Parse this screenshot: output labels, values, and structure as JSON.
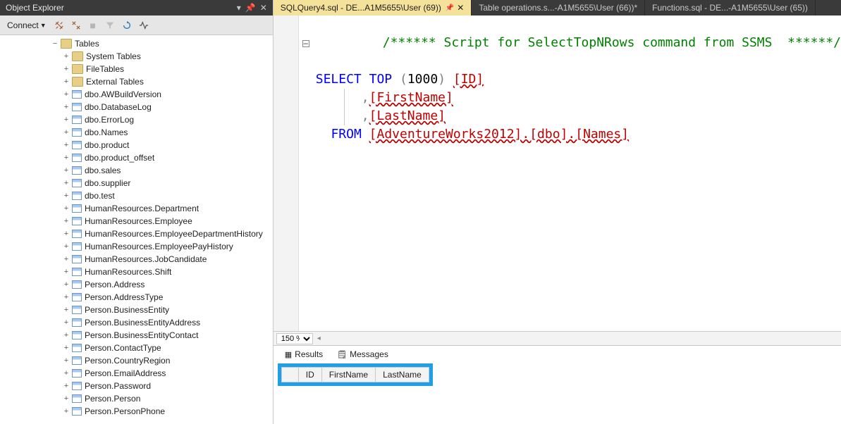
{
  "objectExplorer": {
    "title": "Object Explorer",
    "connectLabel": "Connect",
    "tree": {
      "root": "Tables",
      "folders": [
        "System Tables",
        "FileTables",
        "External Tables"
      ],
      "tables": [
        "dbo.AWBuildVersion",
        "dbo.DatabaseLog",
        "dbo.ErrorLog",
        "dbo.Names",
        "dbo.product",
        "dbo.product_offset",
        "dbo.sales",
        "dbo.supplier",
        "dbo.test",
        "HumanResources.Department",
        "HumanResources.Employee",
        "HumanResources.EmployeeDepartmentHistory",
        "HumanResources.EmployeePayHistory",
        "HumanResources.JobCandidate",
        "HumanResources.Shift",
        "Person.Address",
        "Person.AddressType",
        "Person.BusinessEntity",
        "Person.BusinessEntityAddress",
        "Person.BusinessEntityContact",
        "Person.ContactType",
        "Person.CountryRegion",
        "Person.EmailAddress",
        "Person.Password",
        "Person.Person",
        "Person.PersonPhone"
      ]
    }
  },
  "tabs": [
    {
      "label": "SQLQuery4.sql - DE...A1M5655\\User (69))",
      "active": true,
      "pinned": true
    },
    {
      "label": "Table operations.s...-A1M5655\\User (66))*",
      "active": false
    },
    {
      "label": "Functions.sql - DE...-A1M5655\\User (65))",
      "active": false
    }
  ],
  "sql": {
    "comment": "/****** Script for SelectTopNRows command from SSMS  ******/",
    "selectKw": "SELECT",
    "topKw": "TOP",
    "topNum": "1000",
    "col1": "[ID]",
    "col2": "[FirstName]",
    "col3": "[LastName]",
    "fromKw": "FROM",
    "tableRef": "[AdventureWorks2012].[dbo].[Names]"
  },
  "zoom": {
    "value": "150 %"
  },
  "resultsTabs": {
    "results": "Results",
    "messages": "Messages"
  },
  "resultGrid": {
    "cols": [
      "ID",
      "FirstName",
      "LastName"
    ]
  }
}
